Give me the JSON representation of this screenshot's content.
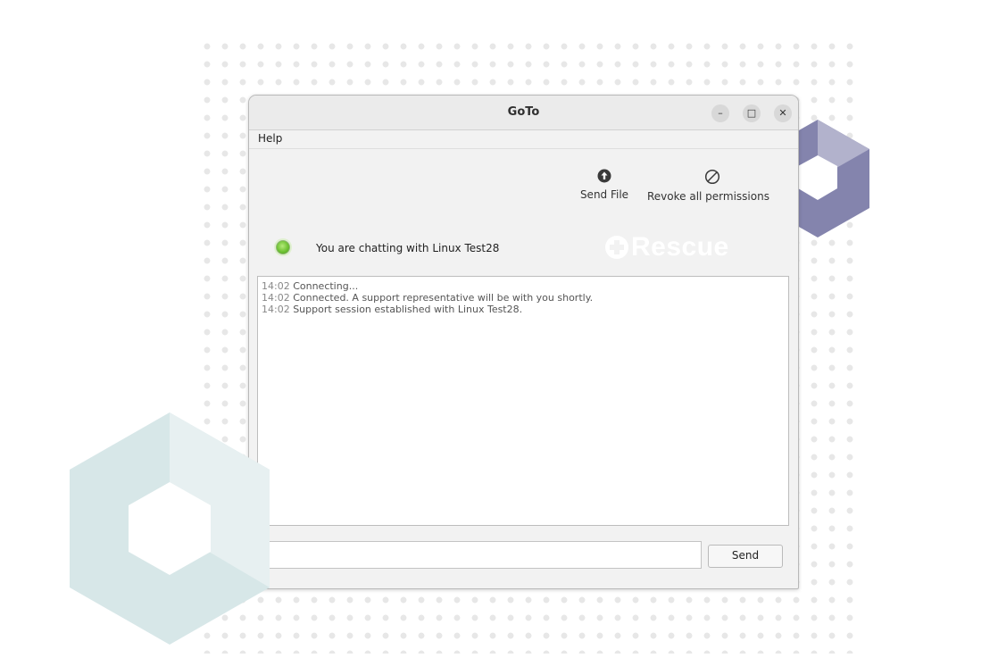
{
  "window": {
    "title": "GoTo",
    "buttons": {
      "minimize": "–",
      "maximize": "□",
      "close": "✕"
    }
  },
  "menu": {
    "help": "Help"
  },
  "toolbar": {
    "send_file": "Send File",
    "revoke": "Revoke all permissions"
  },
  "status": {
    "text": "You are chatting with Linux Test28",
    "color": "#6fc234"
  },
  "brand": {
    "text": "Rescue"
  },
  "chat": {
    "lines": [
      {
        "time": "14:02",
        "text": "Connecting..."
      },
      {
        "time": "14:02",
        "text": "Connected. A support representative will be with you shortly."
      },
      {
        "time": "14:02",
        "text": "Support session established with Linux Test28."
      }
    ]
  },
  "composer": {
    "value": "",
    "send_label": "Send"
  },
  "colors": {
    "accent_purple": "#8484ad",
    "hex_teal": "#d7e7e8"
  }
}
